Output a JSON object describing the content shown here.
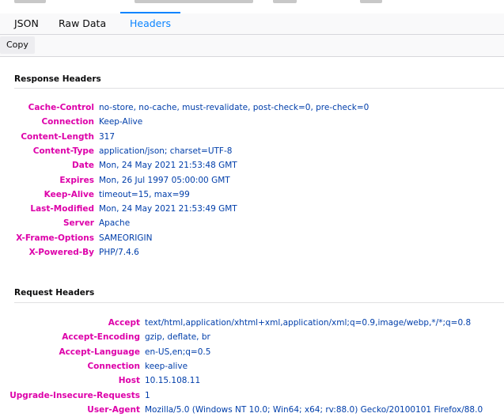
{
  "tabs": [
    {
      "label": "JSON",
      "selected": false
    },
    {
      "label": "Raw Data",
      "selected": false
    },
    {
      "label": "Headers",
      "selected": true
    }
  ],
  "toolbar": {
    "copy_label": "Copy"
  },
  "response": {
    "title": "Response Headers",
    "headers": [
      {
        "name": "Cache-Control",
        "value": "no-store, no-cache, must-revalidate, post-check=0, pre-check=0"
      },
      {
        "name": "Connection",
        "value": "Keep-Alive"
      },
      {
        "name": "Content-Length",
        "value": "317"
      },
      {
        "name": "Content-Type",
        "value": "application/json; charset=UTF-8"
      },
      {
        "name": "Date",
        "value": "Mon, 24 May 2021 21:53:48 GMT"
      },
      {
        "name": "Expires",
        "value": "Mon, 26 Jul 1997 05:00:00 GMT"
      },
      {
        "name": "Keep-Alive",
        "value": "timeout=15, max=99"
      },
      {
        "name": "Last-Modified",
        "value": "Mon, 24 May 2021 21:53:49 GMT"
      },
      {
        "name": "Server",
        "value": "Apache"
      },
      {
        "name": "X-Frame-Options",
        "value": "SAMEORIGIN"
      },
      {
        "name": "X-Powered-By",
        "value": "PHP/7.4.6"
      }
    ]
  },
  "request": {
    "title": "Request Headers",
    "headers": [
      {
        "name": "Accept",
        "value": "text/html,application/xhtml+xml,application/xml;q=0.9,image/webp,*/*;q=0.8"
      },
      {
        "name": "Accept-Encoding",
        "value": "gzip, deflate, br"
      },
      {
        "name": "Accept-Language",
        "value": "en-US,en;q=0.5"
      },
      {
        "name": "Connection",
        "value": "keep-alive"
      },
      {
        "name": "Host",
        "value": "10.15.108.11"
      },
      {
        "name": "Upgrade-Insecure-Requests",
        "value": "1"
      },
      {
        "name": "User-Agent",
        "value": "Mozilla/5.0 (Windows NT 10.0; Win64; x64; rv:88.0) Gecko/20100101 Firefox/88.0"
      }
    ]
  },
  "colors": {
    "header_name": "#dd00a9",
    "header_value": "#003eaa",
    "selected_tab": "#0a84ff"
  }
}
